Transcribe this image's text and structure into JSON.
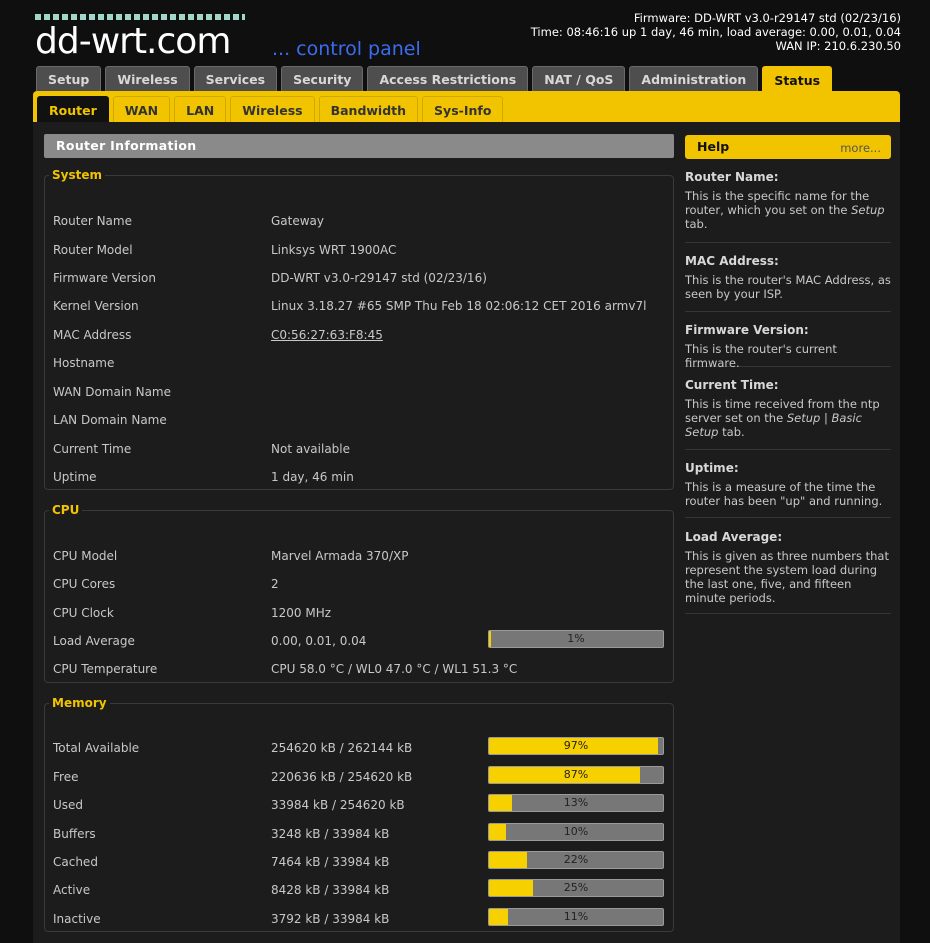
{
  "header": {
    "logo_text": "dd-wrt.com",
    "logo_sub": "... control panel",
    "firmware": "Firmware: DD-WRT v3.0-r29147 std (02/23/16)",
    "time": "Time: 08:46:16 up 1 day, 46 min, load average: 0.00, 0.01, 0.04",
    "wan_ip": "WAN IP: 210.6.230.50"
  },
  "tabs": [
    "Setup",
    "Wireless",
    "Services",
    "Security",
    "Access Restrictions",
    "NAT / QoS",
    "Administration",
    "Status"
  ],
  "subtabs": [
    "Router",
    "WAN",
    "LAN",
    "Wireless",
    "Bandwidth",
    "Sys-Info"
  ],
  "section_title": "Router Information",
  "system": {
    "legend": "System",
    "rows": [
      {
        "label": "Router Name",
        "value": "Gateway"
      },
      {
        "label": "Router Model",
        "value": "Linksys WRT 1900AC"
      },
      {
        "label": "Firmware Version",
        "value": "DD-WRT v3.0-r29147 std (02/23/16)"
      },
      {
        "label": "Kernel Version",
        "value": "Linux 3.18.27 #65 SMP Thu Feb 18 02:06:12 CET 2016 armv7l"
      },
      {
        "label": "MAC Address",
        "value": "C0:56:27:63:F8:45"
      },
      {
        "label": "Hostname",
        "value": ""
      },
      {
        "label": "WAN Domain Name",
        "value": ""
      },
      {
        "label": "LAN Domain Name",
        "value": ""
      },
      {
        "label": "Current Time",
        "value": "Not available"
      },
      {
        "label": "Uptime",
        "value": "1 day, 46 min"
      }
    ]
  },
  "cpu": {
    "legend": "CPU",
    "rows": [
      {
        "label": "CPU Model",
        "value": "Marvel Armada 370/XP"
      },
      {
        "label": "CPU Cores",
        "value": "2"
      },
      {
        "label": "CPU Clock",
        "value": "1200 MHz"
      },
      {
        "label": "Load Average",
        "value": "0.00, 0.01, 0.04",
        "meter": "1%",
        "meter_pct": 1
      },
      {
        "label": "CPU Temperature",
        "value": "CPU 58.0 °C / WL0 47.0 °C / WL1 51.3 °C"
      }
    ]
  },
  "memory": {
    "legend": "Memory",
    "rows": [
      {
        "label": "Total Available",
        "value": "254620 kB / 262144 kB",
        "meter": "97%",
        "meter_pct": 97
      },
      {
        "label": "Free",
        "value": "220636 kB / 254620 kB",
        "meter": "87%",
        "meter_pct": 87
      },
      {
        "label": "Used",
        "value": "33984 kB / 254620 kB",
        "meter": "13%",
        "meter_pct": 13
      },
      {
        "label": "Buffers",
        "value": "3248 kB / 33984 kB",
        "meter": "10%",
        "meter_pct": 10
      },
      {
        "label": "Cached",
        "value": "7464 kB / 33984 kB",
        "meter": "22%",
        "meter_pct": 22
      },
      {
        "label": "Active",
        "value": "8428 kB / 33984 kB",
        "meter": "25%",
        "meter_pct": 25
      },
      {
        "label": "Inactive",
        "value": "3792 kB / 33984 kB",
        "meter": "11%",
        "meter_pct": 11
      }
    ]
  },
  "help": {
    "title": "Help",
    "more": "more...",
    "items": [
      {
        "title": "Router Name:",
        "text_before": "This is the specific name for the router, which you set on the ",
        "italic": "Setup",
        "text_after": " tab."
      },
      {
        "title": "MAC Address:",
        "text_before": "This is the router's MAC Address, as seen by your ISP.",
        "italic": "",
        "text_after": ""
      },
      {
        "title": "Firmware Version:",
        "text_before": "This is the router's current firmware.",
        "italic": "",
        "text_after": ""
      },
      {
        "title": "Current Time:",
        "text_before": "This is time received from the ntp server set on the ",
        "italic": "Setup | Basic Setup",
        "text_after": " tab."
      },
      {
        "title": "Uptime:",
        "text_before": "This is a measure of the time the router has been \"up\" and running.",
        "italic": "",
        "text_after": ""
      },
      {
        "title": "Load Average:",
        "text_before": "This is given as three numbers that represent the system load during the last one, five, and fifteen minute periods.",
        "italic": "",
        "text_after": ""
      }
    ]
  }
}
